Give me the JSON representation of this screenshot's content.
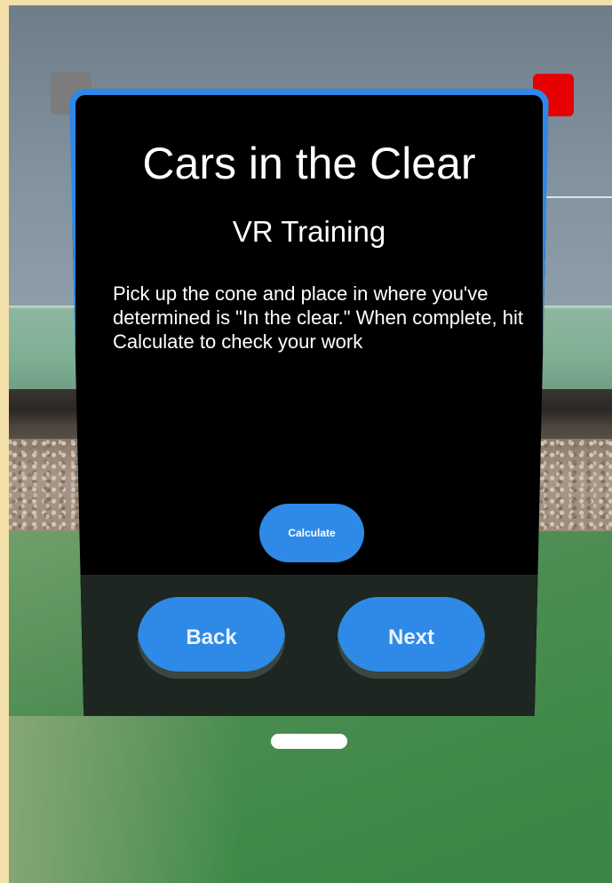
{
  "panel": {
    "title": "Cars in the Clear",
    "subtitle": "VR Training",
    "instructions": "Pick up the cone and place in where you've determined is \"In the clear.\" When complete, hit Calculate to check your work",
    "calculate_label": "Calculate",
    "back_label": "Back",
    "next_label": "Next"
  },
  "colors": {
    "accent": "#2e88e8",
    "close": "#e60000",
    "pin": "#7c7c7c"
  }
}
